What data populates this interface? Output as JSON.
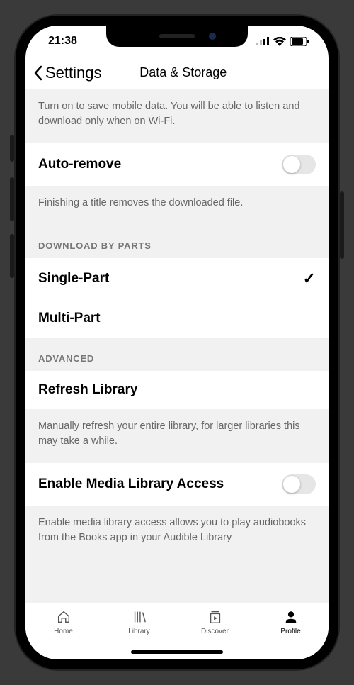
{
  "status": {
    "time": "21:38"
  },
  "nav": {
    "back": "Settings",
    "title": "Data & Storage"
  },
  "top_desc": "Turn on to save mobile data. You will be able to listen and download only when on Wi-Fi.",
  "auto_remove": {
    "label": "Auto-remove",
    "desc": "Finishing a title removes the downloaded file."
  },
  "download_section": {
    "header": "DOWNLOAD BY PARTS",
    "single": "Single-Part",
    "multi": "Multi-Part"
  },
  "advanced": {
    "header": "ADVANCED",
    "refresh": {
      "label": "Refresh Library",
      "desc": "Manually refresh your entire library, for larger libraries this may take a while."
    },
    "media": {
      "label": "Enable Media Library Access",
      "desc": "Enable media library access allows you to play audiobooks from the Books app in your Audible Library"
    }
  },
  "tabs": {
    "home": "Home",
    "library": "Library",
    "discover": "Discover",
    "profile": "Profile"
  }
}
